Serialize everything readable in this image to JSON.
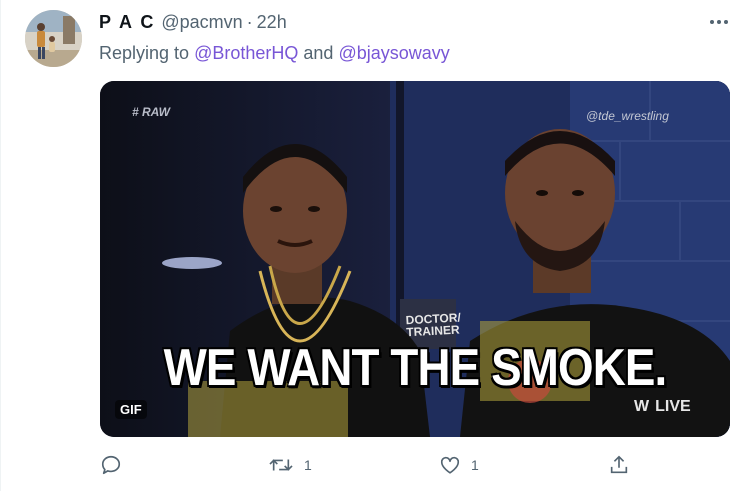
{
  "tweet": {
    "display_name": "P A C",
    "handle": "@pacmvn",
    "separator": "·",
    "timestamp": "22h",
    "replying_prefix": "Replying to",
    "replying_conjunction": "and",
    "mentions": [
      "@BrotherHQ",
      "@bjaysowavy"
    ]
  },
  "media": {
    "caption": "WE WANT THE SMOKE.",
    "badge": "GIF",
    "channel_tag": "# RAW",
    "watermark": "@tde_wrestling",
    "live_label": "LIVE",
    "door_sign": "DOCTOR/ TRAINER"
  },
  "actions": {
    "reply_count": "",
    "retweet_count": "1",
    "like_count": "1"
  },
  "colors": {
    "mention": "#7856d6",
    "muted": "#536471"
  },
  "icons": [
    "more-icon",
    "reply-icon",
    "retweet-icon",
    "like-icon",
    "share-icon"
  ]
}
